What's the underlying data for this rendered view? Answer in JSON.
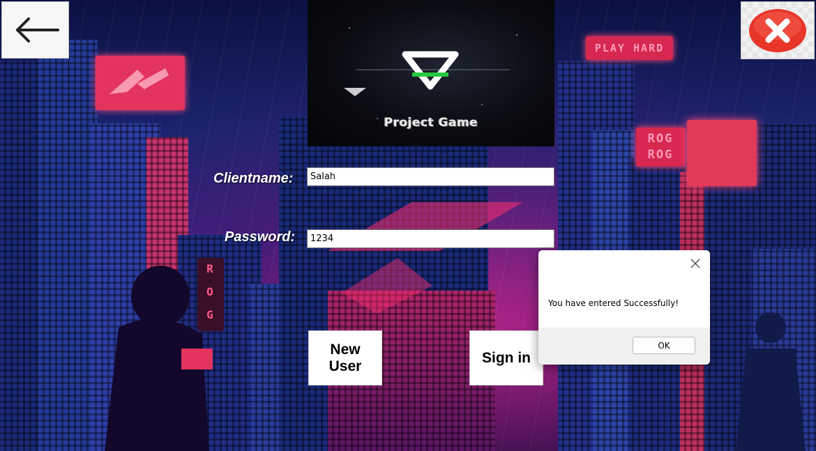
{
  "header": {
    "back_icon": "arrow-left-icon",
    "close_icon": "close-x-icon"
  },
  "logo": {
    "title": "Project Game",
    "icon": "triangle-emblem-icon"
  },
  "background": {
    "sign_play": "PLAY HARD",
    "sign_rog_1": "ROG",
    "sign_rog_2": "ROG",
    "sign_vertical": [
      "R",
      "O",
      "G"
    ]
  },
  "form": {
    "clientname_label": "Clientname:",
    "clientname_value": "Salah",
    "password_label": "Password:",
    "password_value": "1234"
  },
  "buttons": {
    "new_user": "New User",
    "sign_in": "Sign in"
  },
  "dialog": {
    "message": "You have entered Successfully!",
    "ok_label": "OK",
    "close_icon": "close-icon"
  },
  "colors": {
    "close_red": "#e8352a",
    "neon_pink": "#ff3d7a",
    "dialog_footer": "#f0f0f0"
  }
}
